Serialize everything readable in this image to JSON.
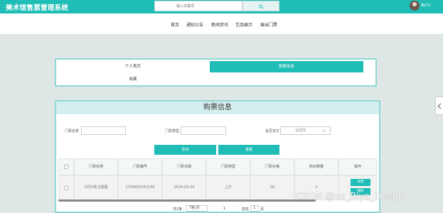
{
  "app": {
    "title": "美术馆售票管理系统"
  },
  "search": {
    "placeholder": "输入关键词"
  },
  "user": {
    "name": "用户2"
  },
  "nav": {
    "items": [
      {
        "label": "首页"
      },
      {
        "label": "通知公告"
      },
      {
        "label": "新闻资讯"
      },
      {
        "label": "艺品展示"
      },
      {
        "label": "展出门票"
      }
    ]
  },
  "tabs": [
    {
      "label": "个人首页"
    },
    {
      "label": "购票信息",
      "active": true
    },
    {
      "label": "收藏"
    }
  ],
  "main": {
    "heading": "购票信息",
    "filters": {
      "ticket_name_label": "门票名称",
      "ticket_type_label": "门票类型",
      "pay_status_label": "是否支付",
      "pay_status_placeholder": "请选择"
    },
    "buttons": {
      "search": "查询",
      "reset": "重置"
    },
    "table": {
      "columns": [
        "",
        "门票名称",
        "门票编号",
        "门票日期",
        "门票类型",
        "门票价格",
        "购买数量",
        "操作"
      ],
      "rows": [
        {
          "name": "3月印象主题展",
          "number": "1709050342135",
          "date": "2024-03-20",
          "type": "上午",
          "price": "58",
          "quantity": "3",
          "actions": [
            "详情",
            "删除"
          ]
        }
      ]
    }
  },
  "pager": {
    "total": "共1条",
    "page_size": "7条/页",
    "current_page": "1",
    "goto_label": "前往",
    "goto_value": "1",
    "page_unit": "页"
  },
  "watermark": "CSDN @vx_Biye_Design",
  "colors": {
    "accent": "#1fbdb6",
    "background": "#dfe7e6"
  }
}
